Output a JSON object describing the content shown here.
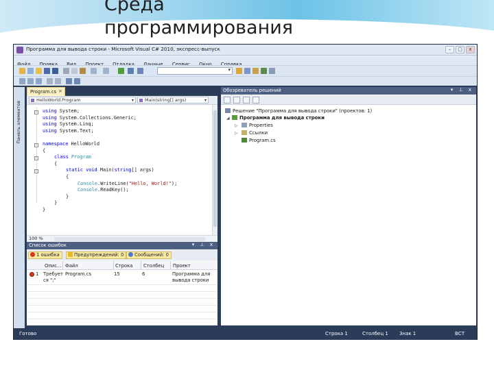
{
  "slide": {
    "title_line1": "Среда",
    "title_line2": "программирования"
  },
  "window": {
    "title": "Программа для вывода строки - Microsoft Visual C# 2010, экспресс-выпуск",
    "buttons": {
      "minimize": "–",
      "maximize": "□",
      "close": "x"
    }
  },
  "menu": [
    "Файл",
    "Правка",
    "Вид",
    "Проект",
    "Отладка",
    "Данные",
    "Сервис",
    "Окно",
    "Справка"
  ],
  "toolbox": {
    "label": "Панель элементов"
  },
  "editor": {
    "tab": "Program.cs",
    "tab_close": "×",
    "nav_class": "HelloWorld.Program",
    "nav_member": "Main(string[] args)",
    "zoom": "100 %"
  },
  "code": {
    "l1": [
      "using",
      " System;"
    ],
    "l2": [
      "using",
      " System.Collections.Generic;"
    ],
    "l3": [
      "using",
      " System.Linq;"
    ],
    "l4": [
      "using",
      " System.Text;"
    ],
    "l6": [
      "namespace",
      " HelloWorld"
    ],
    "l7": "{",
    "l8": [
      "class",
      " ",
      "Program"
    ],
    "l9": "{",
    "l10": [
      "static",
      " ",
      "void",
      " Main(",
      "string",
      "[] args)"
    ],
    "l11": "{",
    "l12": [
      "Console",
      ".WriteLine(",
      "\"Hello, World!\"",
      ");"
    ],
    "l13": [
      "Console",
      ".ReadKey();"
    ],
    "l14": "}",
    "l15": "}",
    "l16": "}"
  },
  "solution_explorer": {
    "title": "Обозреватель решений",
    "pane_controls": "▾ ⊥ x",
    "solution": "Решение \"Программа для вывода строки\"  (проектов: 1)",
    "project": "Программа для вывода строки",
    "properties": "Properties",
    "references": "Ссылки",
    "file": "Program.cs"
  },
  "error_list": {
    "title": "Список ошибок",
    "pane_controls": "▾ ⊥ x",
    "errors_btn": "1 ошибка",
    "warnings_btn": "Предупреждений: 0",
    "messages_btn": "Сообщений: 0",
    "columns": [
      "Опис...",
      "Файл",
      "Строка",
      "Столбец",
      "Проект"
    ],
    "row": {
      "num": "1",
      "desc_line1": "Требует",
      "desc_line2": "ся \";\"",
      "file": "Program.cs",
      "line": "15",
      "column": "6",
      "project_line1": "Программа для",
      "project_line2": "вывода строки"
    }
  },
  "status": {
    "ready": "Готово",
    "line": "Строка 1",
    "col": "Столбец 1",
    "char": "Знак 1",
    "mode": "ВСТ"
  },
  "colors": {
    "frame": "#2b3c59",
    "tab_active": "#fdf1c4",
    "keyword": "#0000ff",
    "type": "#2b91af",
    "string": "#a31515"
  }
}
